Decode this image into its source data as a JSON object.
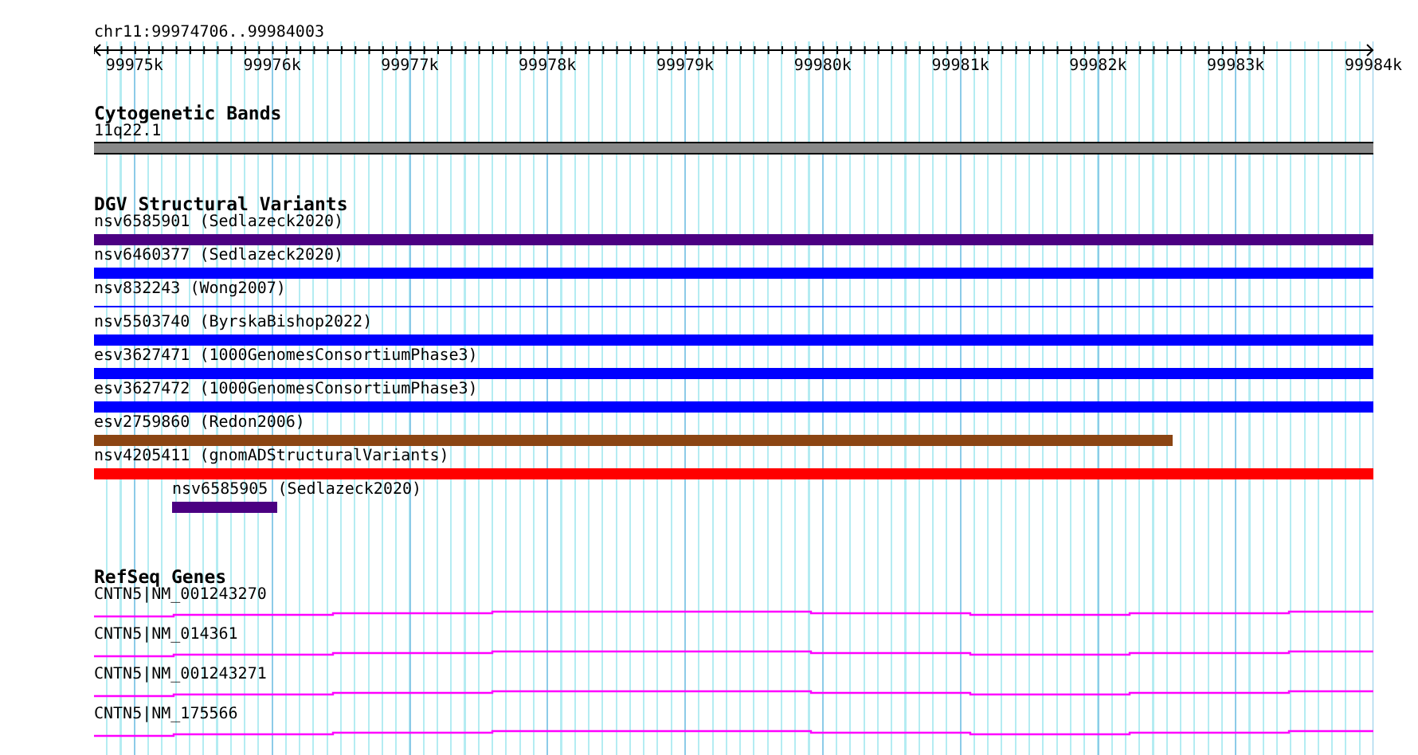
{
  "ruler": {
    "location": "chr11:99974706..99984003",
    "ticks": [
      "99975k",
      "99976k",
      "99977k",
      "99978k",
      "99979k",
      "99980k",
      "99981k",
      "99982k",
      "99983k",
      "99984k"
    ]
  },
  "cytogenetic_bands": {
    "title": "Cytogenetic Bands",
    "band": "11q22.1"
  },
  "dgv_structural_variants": {
    "title": "DGV Structural Variants",
    "features": [
      {
        "label": "nsv6585901 (Sedlazeck2020)",
        "color": "#4b0082",
        "kind": "full",
        "level": 1
      },
      {
        "label": "nsv6460377 (Sedlazeck2020)",
        "color": "#0000ff",
        "kind": "full",
        "level": 1
      },
      {
        "label": "nsv832243 (Wong2007)",
        "color": "#0000ff",
        "kind": "thin",
        "level": 1
      },
      {
        "label": "nsv5503740 (ByrskaBishop2022)",
        "color": "#0000ff",
        "kind": "full",
        "level": 1
      },
      {
        "label": "esv3627471 (1000GenomesConsortiumPhase3)",
        "color": "#0000ff",
        "kind": "full",
        "level": 1
      },
      {
        "label": "esv3627472 (1000GenomesConsortiumPhase3)",
        "color": "#0000ff",
        "kind": "full",
        "level": 1
      },
      {
        "label": "esv2759860 (Redon2006)",
        "color": "#8b4513",
        "kind": "full",
        "level": 0.843
      },
      {
        "label": "nsv4205411 (gnomADStructuralVariants)",
        "color": "#ff0000",
        "kind": "full",
        "level": 1
      },
      {
        "label": "nsv6585905",
        "source": "(Sedlazeck2020)",
        "color": "#4b0082",
        "kind": "inset",
        "level": 0.082
      }
    ]
  },
  "refseq_genes": {
    "title": "RefSeq Genes",
    "genes": [
      "CNTN5|NM_001243270",
      "CNTN5|NM_014361",
      "CNTN5|NM_001243271",
      "CNTN5|NM_175566"
    ]
  }
}
